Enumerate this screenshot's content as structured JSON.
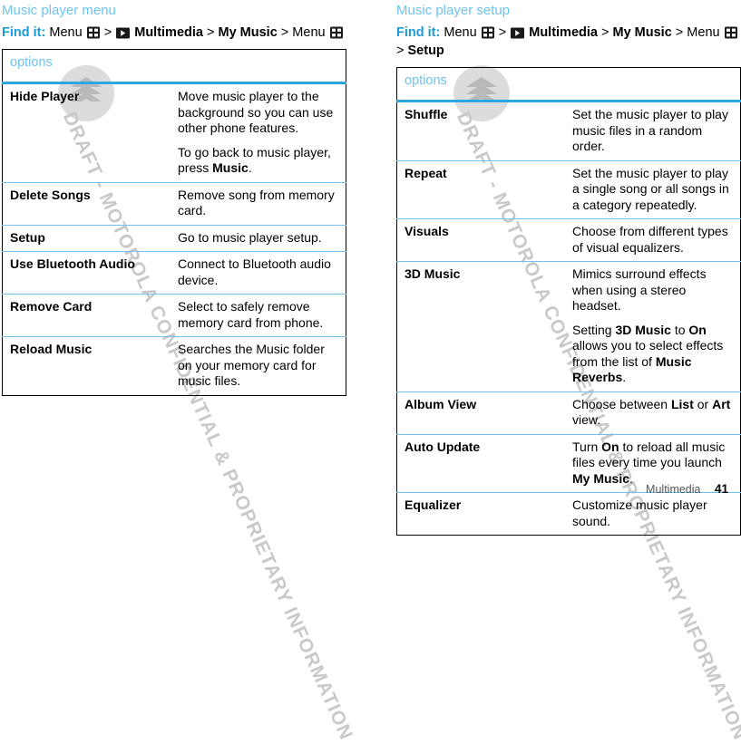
{
  "document": {
    "footer": {
      "chapter": "Multimedia",
      "page_number": "41"
    },
    "watermark": {
      "text": "DRAFT - MOTOROLA CONFIDENTIAL & PROPRIETARY INFORMATION",
      "logo_icon": "motorola-batwing-logo"
    },
    "colors": {
      "heading": "#6fc3ef",
      "findit_label": "#1b9ad6",
      "header_rule": "#2ba6e0",
      "row_rule": "#6fc3ef",
      "table_border": "#000000",
      "watermark": "#c9c9c9"
    }
  },
  "sections": [
    {
      "title": "Music player menu",
      "findit": {
        "label": "Find it:",
        "steps": [
          {
            "text": "Menu",
            "icon": "menu-grid-icon",
            "bold": false
          },
          {
            "text": "Multimedia",
            "icon": "multimedia-play-icon",
            "bold": true
          },
          {
            "text": "My Music",
            "icon": null,
            "bold": true
          },
          {
            "text": "Menu",
            "icon": "menu-grid-icon",
            "bold": false
          }
        ],
        "separator": ">"
      },
      "table": {
        "header": "options",
        "rows": [
          {
            "key": "Hide Player",
            "paragraphs": [
              [
                {
                  "t": "Move music player to the background so you can use other phone features.",
                  "b": false
                }
              ],
              [
                {
                  "t": "To go back to music player, press ",
                  "b": false
                },
                {
                  "t": "Music",
                  "b": true
                },
                {
                  "t": ".",
                  "b": false
                }
              ]
            ]
          },
          {
            "key": "Delete Songs",
            "paragraphs": [
              [
                {
                  "t": "Remove song from memory card.",
                  "b": false
                }
              ]
            ]
          },
          {
            "key": "Setup",
            "paragraphs": [
              [
                {
                  "t": "Go to music player setup.",
                  "b": false
                }
              ]
            ]
          },
          {
            "key": "Use Bluetooth Audio",
            "paragraphs": [
              [
                {
                  "t": "Connect to Bluetooth audio device.",
                  "b": false
                }
              ]
            ]
          },
          {
            "key": "Remove Card",
            "paragraphs": [
              [
                {
                  "t": "Select to safely remove memory card from phone.",
                  "b": false
                }
              ]
            ]
          },
          {
            "key": "Reload Music",
            "paragraphs": [
              [
                {
                  "t": "Searches the Music folder on your memory card for music files.",
                  "b": false
                }
              ]
            ]
          }
        ]
      }
    },
    {
      "title": "Music player setup",
      "findit": {
        "label": "Find it:",
        "steps": [
          {
            "text": "Menu",
            "icon": "menu-grid-icon",
            "bold": false
          },
          {
            "text": "Multimedia",
            "icon": "multimedia-play-icon",
            "bold": true
          },
          {
            "text": "My Music",
            "icon": null,
            "bold": true
          },
          {
            "text": "Menu",
            "icon": "menu-grid-icon",
            "bold": false
          },
          {
            "text": "Setup",
            "icon": null,
            "bold": true
          }
        ],
        "separator": ">"
      },
      "table": {
        "header": "options",
        "rows": [
          {
            "key": "Shuffle",
            "paragraphs": [
              [
                {
                  "t": "Set the music player to play music files in a random order.",
                  "b": false
                }
              ]
            ]
          },
          {
            "key": "Repeat",
            "paragraphs": [
              [
                {
                  "t": "Set the music player to play a single song or all songs in a category repeatedly.",
                  "b": false
                }
              ]
            ]
          },
          {
            "key": "Visuals",
            "paragraphs": [
              [
                {
                  "t": "Choose from different types of visual equalizers.",
                  "b": false
                }
              ]
            ]
          },
          {
            "key": "3D Music",
            "paragraphs": [
              [
                {
                  "t": "Mimics surround effects when using a stereo headset.",
                  "b": false
                }
              ],
              [
                {
                  "t": "Setting ",
                  "b": false
                },
                {
                  "t": "3D Music",
                  "b": true
                },
                {
                  "t": " to ",
                  "b": false
                },
                {
                  "t": "On",
                  "b": true
                },
                {
                  "t": " allows you to select effects from the list of ",
                  "b": false
                },
                {
                  "t": "Music Reverbs",
                  "b": true
                },
                {
                  "t": ".",
                  "b": false
                }
              ]
            ]
          },
          {
            "key": "Album View",
            "paragraphs": [
              [
                {
                  "t": "Choose between ",
                  "b": false
                },
                {
                  "t": "List",
                  "b": true
                },
                {
                  "t": " or ",
                  "b": false
                },
                {
                  "t": "Art",
                  "b": true
                },
                {
                  "t": " view.",
                  "b": false
                }
              ]
            ]
          },
          {
            "key": "Auto Update",
            "paragraphs": [
              [
                {
                  "t": "Turn ",
                  "b": false
                },
                {
                  "t": "On",
                  "b": true
                },
                {
                  "t": " to reload all music files every time you launch ",
                  "b": false
                },
                {
                  "t": "My Music",
                  "b": true
                },
                {
                  "t": ".",
                  "b": false
                }
              ]
            ]
          },
          {
            "key": "Equalizer",
            "paragraphs": [
              [
                {
                  "t": "Customize music player sound.",
                  "b": false
                }
              ]
            ]
          }
        ]
      }
    }
  ]
}
